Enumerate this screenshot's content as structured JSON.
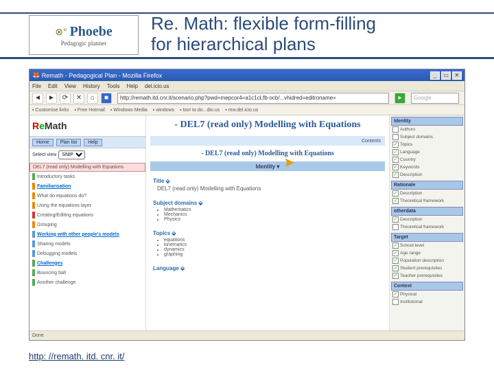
{
  "slide": {
    "title_line1": "Re. Math: flexible form-filling",
    "title_line2": "for hierarchical plans",
    "logo_name": "Phoebe",
    "logo_sub": "Pedagogic planner",
    "footer_link": "http: //remath. itd. cnr. it/"
  },
  "browser": {
    "window_title": "Remath - Pedagogical Plan - Mozilla Firefox",
    "menu": [
      "File",
      "Edit",
      "View",
      "History",
      "Tools",
      "Help",
      "del.icio.us"
    ],
    "url": "http://remath.itd.cnr.it/scenario.php?pwd=mepcor4=a1c1cLfb-ocb/...vhidred=editroname=",
    "search_placeholder": "Google",
    "bookmarks": [
      "Customise links",
      "Free Hotmail",
      "Windows Media",
      "windows",
      "too! to do...dio.us",
      "mw.del.icio.us"
    ],
    "status": "Done"
  },
  "nav": {
    "buttons": [
      "Home",
      "Plan list",
      "Help"
    ]
  },
  "select": {
    "label": "Select view",
    "value": "SNIP"
  },
  "tree": {
    "selected": "DEL7 (read only) Modelling with Equations",
    "items": [
      {
        "t": "Introductory tasks",
        "c": "g"
      },
      {
        "t": "Familiarisation",
        "c": "o",
        "grp": true
      },
      {
        "t": "What do equations do?",
        "c": "o"
      },
      {
        "t": "Using the equations layer",
        "c": "o"
      },
      {
        "t": "Creating/Editing equations",
        "c": "r"
      },
      {
        "t": "Grouping",
        "c": "o"
      },
      {
        "t": "Working with other people's models",
        "c": "b",
        "grp": true
      },
      {
        "t": "Sharing models",
        "c": "b"
      },
      {
        "t": "Debugging models",
        "c": "b"
      },
      {
        "t": "Challenges",
        "c": "g",
        "grp": true
      },
      {
        "t": "Bouncing ball",
        "c": "g"
      },
      {
        "t": "Another challenge",
        "c": "g"
      }
    ]
  },
  "page": {
    "title": "- DEL7 (read only) Modelling with Equations",
    "sub_title": "- DEL7 (read only) Modelling with Equations",
    "identity_label": "Identity ▾",
    "sections": {
      "title": {
        "h": "Title ⬙",
        "body": "DEL7 (read only) Modelling with Equations"
      },
      "subject": {
        "h": "Subject domains ⬙",
        "items": [
          "Mathematics",
          "Mechanics",
          "Physics"
        ]
      },
      "topics": {
        "h": "Topics ⬙",
        "items": [
          "equations",
          "kinematics",
          "dynamics",
          "graphing"
        ]
      },
      "language": {
        "h": "Language ⬙"
      }
    },
    "tab_right": "Contents"
  },
  "right": {
    "groups": [
      {
        "head": "Identity",
        "items": [
          {
            "l": "Authors",
            "c": 0
          },
          {
            "l": "Subject domains",
            "c": 0
          },
          {
            "l": "Topics",
            "c": 1
          },
          {
            "l": "Language",
            "c": 1
          },
          {
            "l": "Country",
            "c": 1
          },
          {
            "l": "Keywords",
            "c": 1
          },
          {
            "l": "Description",
            "c": 1
          }
        ]
      },
      {
        "head": "Rationale",
        "items": [
          {
            "l": "Description",
            "c": 1
          },
          {
            "l": "Theoretical framework",
            "c": 1
          }
        ]
      },
      {
        "head": "otherdata",
        "items": [
          {
            "l": "Description",
            "c": 1
          },
          {
            "l": "Theoretical framework",
            "c": 0
          }
        ]
      },
      {
        "head": "Target",
        "items": [
          {
            "l": "School level",
            "c": 1
          },
          {
            "l": "Age range",
            "c": 1
          },
          {
            "l": "Population description",
            "c": 1
          },
          {
            "l": "Student prerequisites",
            "c": 1
          },
          {
            "l": "Teacher prerequisites",
            "c": 1
          }
        ]
      },
      {
        "head": "Context",
        "items": [
          {
            "l": "Physical",
            "c": 1
          },
          {
            "l": "Institutional",
            "c": 0
          }
        ]
      }
    ]
  }
}
